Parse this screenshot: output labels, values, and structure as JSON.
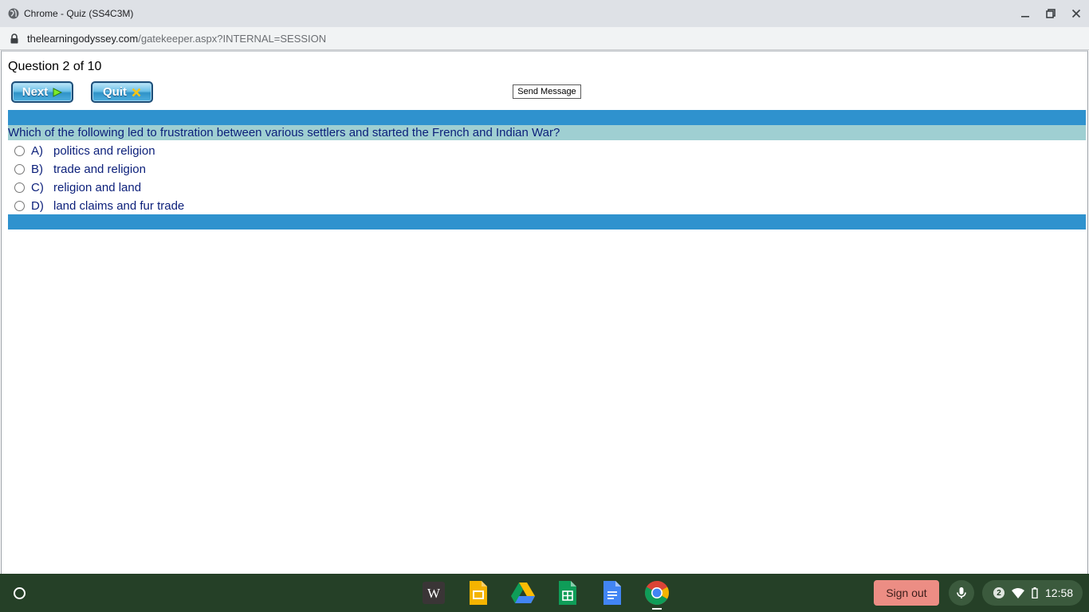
{
  "window": {
    "title": "Chrome - Quiz (SS4C3M)",
    "minimize_icon": "minimize-icon",
    "restore_icon": "restore-icon",
    "close_icon": "close-icon"
  },
  "address_bar": {
    "domain": "thelearningodyssey.com",
    "path": "/gatekeeper.aspx?INTERNAL=SESSION"
  },
  "quiz": {
    "counter": "Question 2 of 10",
    "next_label": "Next",
    "quit_label": "Quit",
    "send_message_label": "Send Message",
    "question": "Which of the following led to frustration between various settlers and started the French and Indian War?",
    "answers": [
      {
        "letter": "A)",
        "text": "politics and religion"
      },
      {
        "letter": "B)",
        "text": "trade and religion"
      },
      {
        "letter": "C)",
        "text": "religion and land"
      },
      {
        "letter": "D)",
        "text": "land claims and fur trade"
      }
    ],
    "colors": {
      "bar_blue": "#2f92ce",
      "question_bg": "#9fcfd2",
      "text_navy": "#0b1f7a"
    }
  },
  "shelf": {
    "apps": [
      "wikipedia-icon",
      "google-slides-icon",
      "google-drive-icon",
      "google-sheets-icon",
      "google-docs-icon",
      "chrome-icon"
    ],
    "wiki_letter": "W",
    "sign_out_label": "Sign out",
    "notification_count": "2",
    "time": "12:58"
  }
}
